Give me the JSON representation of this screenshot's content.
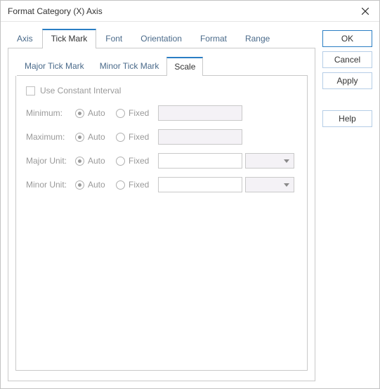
{
  "window": {
    "title": "Format Category (X) Axis"
  },
  "buttons": {
    "ok": "OK",
    "cancel": "Cancel",
    "apply": "Apply",
    "help": "Help"
  },
  "tabs": {
    "outer": {
      "axis": "Axis",
      "tickmark": "Tick Mark",
      "font": "Font",
      "orientation": "Orientation",
      "format": "Format",
      "range": "Range"
    },
    "inner": {
      "major": "Major Tick Mark",
      "minor": "Minor Tick Mark",
      "scale": "Scale"
    }
  },
  "scale": {
    "useConstant": "Use Constant Interval",
    "labels": {
      "minimum": "Minimum:",
      "maximum": "Maximum:",
      "majorUnit": "Major Unit:",
      "minorUnit": "Minor Unit:"
    },
    "radio": {
      "auto": "Auto",
      "fixed": "Fixed"
    },
    "values": {
      "minimum": "",
      "maximum": "",
      "majorUnit": "",
      "minorUnit": ""
    },
    "combos": {
      "majorUnit": "",
      "minorUnit": ""
    }
  }
}
